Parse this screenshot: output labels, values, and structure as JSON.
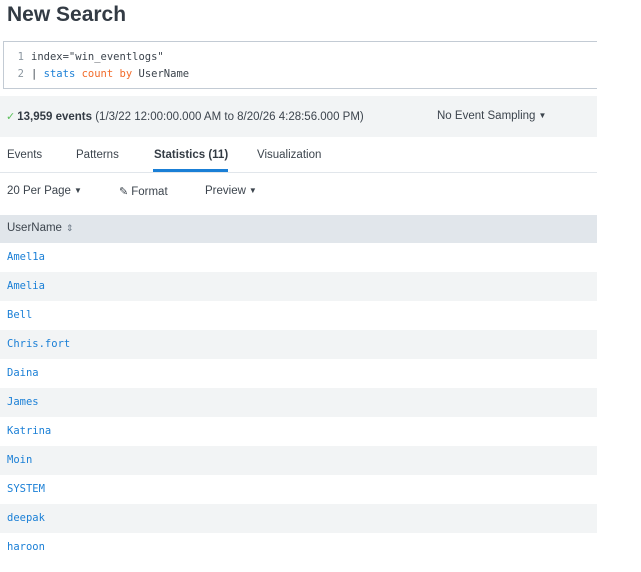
{
  "header": {
    "title": "New Search"
  },
  "search": {
    "lines": [
      {
        "num": "1",
        "text": "index=\"win_eventlogs\""
      },
      {
        "num": "2",
        "pipe": "| ",
        "cmd": "stats",
        "space1": " ",
        "func": "count",
        "space2": " ",
        "kw": "by",
        "space3": " ",
        "field": "UserName"
      }
    ]
  },
  "summary": {
    "check": "✓",
    "count": "13,959 events",
    "range": " (1/3/22 12:00:00.000 AM to 8/20/26 4:28:56.000 PM)",
    "sampling": "No Event Sampling"
  },
  "tabs": [
    {
      "label": "Events"
    },
    {
      "label": "Patterns"
    },
    {
      "label": "Statistics (11)"
    },
    {
      "label": "Visualization"
    }
  ],
  "toolbar": {
    "per_page": "20 Per Page",
    "format": "Format",
    "preview": "Preview"
  },
  "table": {
    "column": "UserName",
    "sort_glyph": "⇕",
    "rows": [
      "Amel1a",
      "Amelia",
      "Bell",
      "Chris.fort",
      "Daina",
      "James",
      "Katrina",
      "Moin",
      "SYSTEM",
      "deepak",
      "haroon"
    ]
  },
  "colors": {
    "accent": "#1a7fd6",
    "keyword": "#f26b2a",
    "success": "#5cc05c",
    "band": "#f2f4f5",
    "header_bg": "#e1e6eb"
  }
}
